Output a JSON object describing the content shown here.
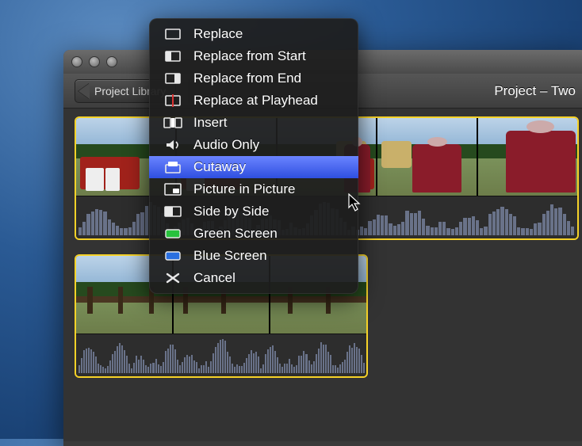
{
  "toolbar": {
    "back_label": "Project Library",
    "title": "Project – Two"
  },
  "menu": {
    "items": [
      {
        "icon": "replace-icon",
        "label": "Replace"
      },
      {
        "icon": "replace-start-icon",
        "label": "Replace from Start"
      },
      {
        "icon": "replace-end-icon",
        "label": "Replace from End"
      },
      {
        "icon": "replace-playhead-icon",
        "label": "Replace at Playhead"
      },
      {
        "icon": "insert-icon",
        "label": "Insert"
      },
      {
        "icon": "audio-icon",
        "label": "Audio Only"
      },
      {
        "icon": "cutaway-icon",
        "label": "Cutaway"
      },
      {
        "icon": "pip-icon",
        "label": "Picture in Picture"
      },
      {
        "icon": "sidebyside-icon",
        "label": "Side by Side"
      },
      {
        "icon": "green-screen-icon",
        "label": "Green Screen"
      },
      {
        "icon": "blue-screen-icon",
        "label": "Blue Screen"
      },
      {
        "icon": "cancel-icon",
        "label": "Cancel"
      }
    ],
    "selected_index": 6
  }
}
